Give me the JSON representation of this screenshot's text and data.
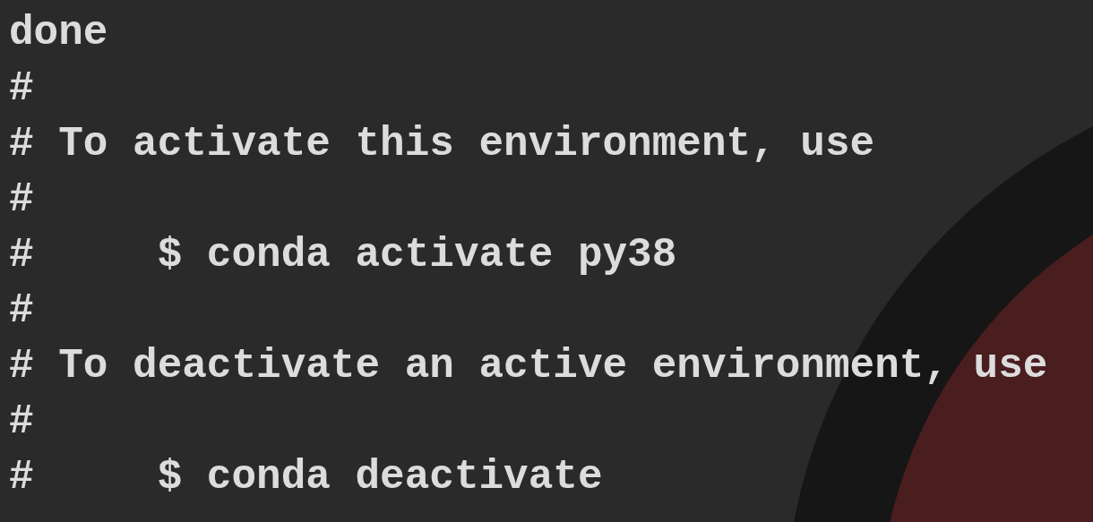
{
  "terminal": {
    "lines": [
      "done",
      "#",
      "# To activate this environment, use",
      "#",
      "#     $ conda activate py38",
      "#",
      "# To deactivate an active environment, use",
      "#",
      "#     $ conda deactivate"
    ]
  }
}
